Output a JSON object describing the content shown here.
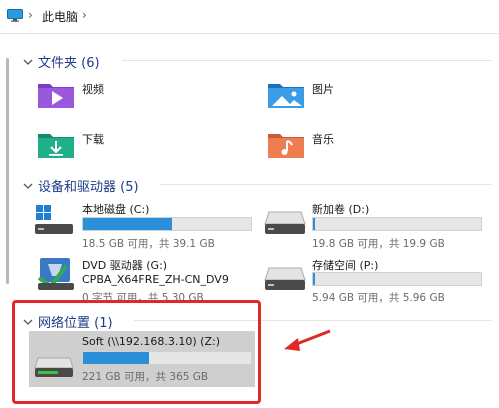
{
  "breadcrumb": {
    "location": "此电脑"
  },
  "folders_group": {
    "header": "文件夹 (6)",
    "items": [
      {
        "label": "视频",
        "icon": "video-folder-icon"
      },
      {
        "label": "图片",
        "icon": "pictures-folder-icon"
      },
      {
        "label": "下载",
        "icon": "downloads-folder-icon"
      },
      {
        "label": "音乐",
        "icon": "music-folder-icon"
      }
    ]
  },
  "devices_group": {
    "header": "设备和驱动器 (5)",
    "items": [
      {
        "name": "本地磁盘 (C:)",
        "size": "18.5 GB 可用，共 39.1 GB",
        "used_fraction": 0.53
      },
      {
        "name": "新加卷 (D:)",
        "size": "19.8 GB 可用，共 19.9 GB",
        "used_fraction": 0.01
      },
      {
        "name": "DVD 驱动器 (G:)",
        "subname": "CPBA_X64FRE_ZH-CN_DV9",
        "size": "0 字节 可用，共 5.30 GB"
      },
      {
        "name": "存储空间 (P:)",
        "size": "5.94 GB 可用，共 5.96 GB",
        "used_fraction": 0.01
      }
    ]
  },
  "network_group": {
    "header": "网络位置 (1)",
    "items": [
      {
        "name": "Soft (\\\\192.168.3.10) (Z:)",
        "size": "221 GB 可用，共 365 GB",
        "used_fraction": 0.39
      }
    ]
  },
  "colors": {
    "accent": "#2a8fd8",
    "highlight": "#e02828",
    "header_text": "#1f3a8a"
  }
}
